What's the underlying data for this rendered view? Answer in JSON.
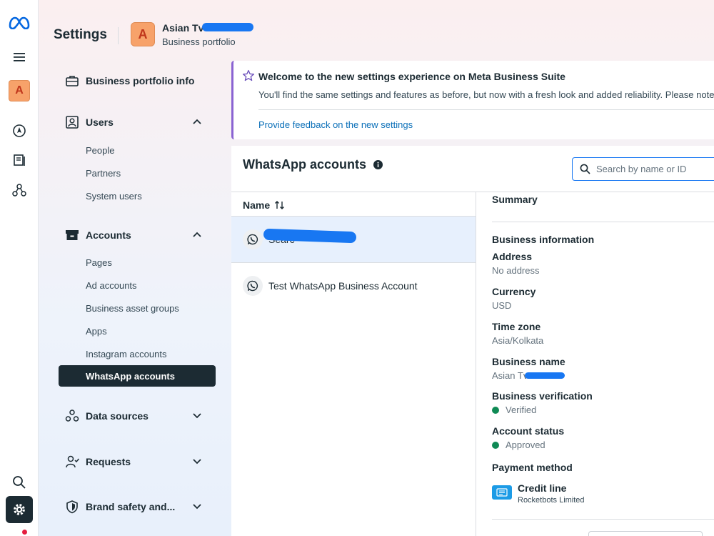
{
  "header": {
    "settings_title": "Settings",
    "business_avatar_letter": "A",
    "business_name": "Asian Tv C",
    "business_subtitle": "Business portfolio"
  },
  "rail": {
    "avatar_letter": "A",
    "icons": [
      "meta-logo-icon",
      "menu-icon",
      "compass-icon",
      "book-icon",
      "network-icon",
      "search-icon",
      "gear-icon"
    ]
  },
  "sidebar": {
    "business_portfolio_info": "Business portfolio info",
    "users": {
      "label": "Users",
      "items": [
        "People",
        "Partners",
        "System users"
      ]
    },
    "accounts": {
      "label": "Accounts",
      "items": [
        "Pages",
        "Ad accounts",
        "Business asset groups",
        "Apps",
        "Instagram accounts"
      ],
      "active": "WhatsApp accounts"
    },
    "data_sources": "Data sources",
    "requests": "Requests",
    "brand_safety": "Brand safety and..."
  },
  "banner": {
    "title": "Welcome to the new settings experience on Meta Business Suite",
    "body": "You'll find the same settings and features as before, but now with a fresh look and added reliability. Please note",
    "link": "Provide feedback on the new settings"
  },
  "content": {
    "title": "WhatsApp accounts",
    "search_placeholder": "Search by name or ID",
    "column_name": "Name",
    "rows": [
      {
        "name": "Searc"
      },
      {
        "name": "Test WhatsApp Business Account"
      }
    ]
  },
  "summary": {
    "title": "Summary",
    "section": "Business information",
    "address_label": "Address",
    "address_value": "No address",
    "currency_label": "Currency",
    "currency_value": "USD",
    "timezone_label": "Time zone",
    "timezone_value": "Asia/Kolkata",
    "business_name_label": "Business name",
    "business_name_value": "Asian Tv",
    "verification_label": "Business verification",
    "verification_value": "Verified",
    "status_label": "Account status",
    "status_value": "Approved",
    "payment_label": "Payment method",
    "payment_title": "Credit line",
    "payment_sub": "Rocketbots Limited",
    "status_color": "#0f8a55"
  }
}
